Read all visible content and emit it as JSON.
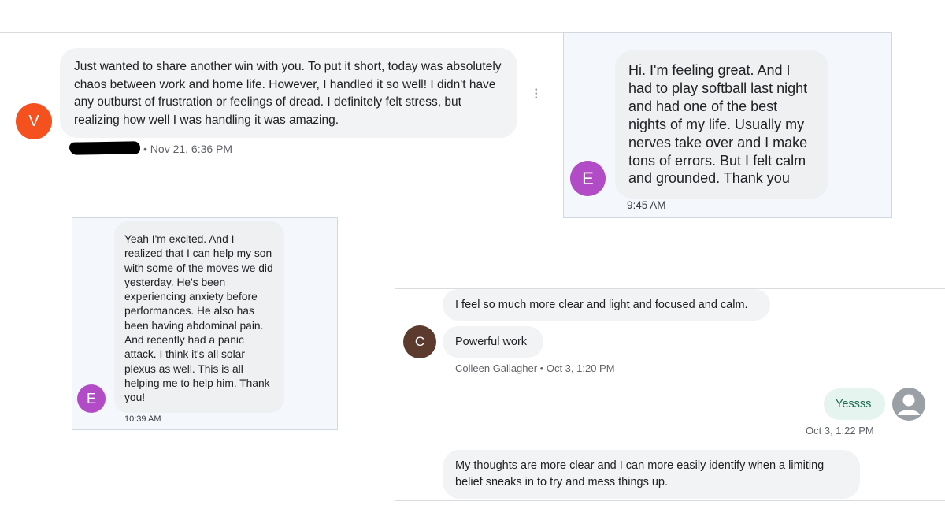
{
  "panel1": {
    "avatar_letter": "V",
    "message": "Just wanted to share another win with you. To put it short, today was absolutely chaos between work and home life. However, I handled it so well! I didn't have any outburst of frustration or feelings of dread. I definitely felt stress, but realizing how well I was handling it was amazing.",
    "timestamp": "• Nov 21, 6:36 PM",
    "avatar_color": "#f4511e"
  },
  "panel2": {
    "avatar_letter": "E",
    "message": "Hi. I'm feeling great. And I had to play softball last night and had one of the best nights of my life. Usually my nerves take over and I make tons of errors. But I felt calm and grounded. Thank you",
    "timestamp": "9:45 AM",
    "avatar_color": "#b24bc6"
  },
  "panel3": {
    "avatar_letter": "E",
    "message": "Yeah I'm excited. And I realized that I can help my son with some of the moves we did yesterday. He's been experiencing anxiety before performances. He also has been having abdominal pain. And recently had a panic attack. I think it's all solar plexus as well. This is all helping me to help him. Thank you!",
    "timestamp": "10:39 AM",
    "avatar_color": "#b24bc6"
  },
  "panel4": {
    "message1": "I feel so much more clear and light and focused and calm.",
    "avatar_letter": "C",
    "message2": "Powerful work",
    "sender_meta": "Colleen Gallagher • Oct 3, 1:20 PM",
    "reply": "Yessss",
    "reply_timestamp": "Oct 3, 1:22 PM",
    "message3": "My thoughts are more clear and I can more easily identify when a limiting belief sneaks in to try and mess things up.",
    "avatar_color": "#5d3a2e",
    "reply_bubble_color": "#e6f4ef"
  }
}
